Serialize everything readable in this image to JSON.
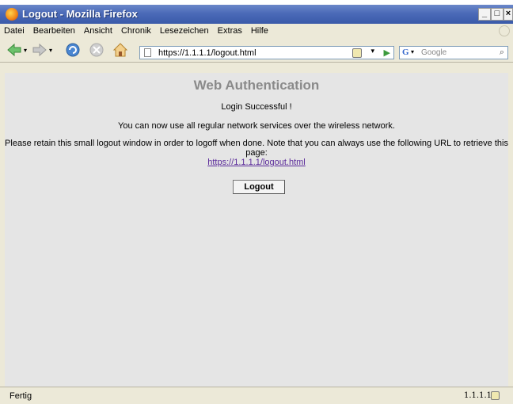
{
  "window": {
    "title": "Logout - Mozilla Firefox"
  },
  "menubar": {
    "items": [
      "Datei",
      "Bearbeiten",
      "Ansicht",
      "Chronik",
      "Lesezeichen",
      "Extras",
      "Hilfe"
    ]
  },
  "toolbar": {
    "url": "https://1.1.1.1/logout.html",
    "search_placeholder": "Google"
  },
  "page": {
    "heading": "Web Authentication",
    "line1": "Login Successful !",
    "line2": "You can now use all regular network services over the wireless network.",
    "line3a": "Please retain this small logout window in order to logoff when done. Note that you can always use the following URL to retrieve this",
    "line3b": "page:",
    "link": "https://1.1.1.1/logout.html",
    "button": "Logout"
  },
  "status": {
    "text": "Fertig",
    "host": "1.1.1.1"
  }
}
